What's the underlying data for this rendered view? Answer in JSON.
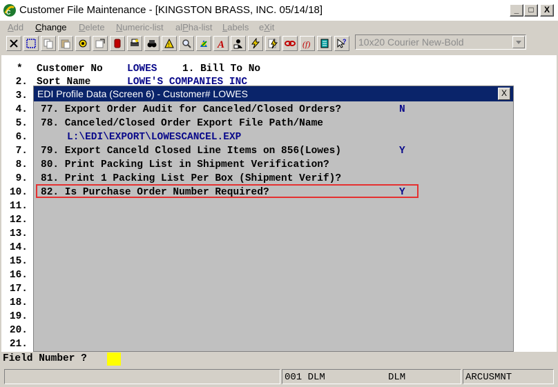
{
  "window": {
    "title": "Customer File Maintenance - [KINGSTON BRASS, INC. 05/14/18]",
    "minimize": "_",
    "maximize": "□",
    "close": "X"
  },
  "menu": {
    "add": "dd",
    "add_u": "A",
    "change": "hange",
    "change_u": "C",
    "delete": "elete",
    "delete_u": "D",
    "numeric_list": "umeric-list",
    "numeric_list_u": "N",
    "alpha_list_pre": "al",
    "alpha_list_u": "P",
    "alpha_list_post": "ha-list",
    "labels": "abels",
    "labels_u": "L",
    "exit_pre": "e",
    "exit_u": "X",
    "exit_post": "it"
  },
  "toolbar": {
    "font_combo_value": "10x20 Courier New-Bold",
    "icons": [
      "close-x-icon",
      "select-icon",
      "copy-icon",
      "paste-icon",
      "settings-icon",
      "properties-icon",
      "database-icon",
      "print-icon",
      "binoculars-icon",
      "warning-icon",
      "search-icon",
      "palette-icon",
      "font-a-icon",
      "person-icon",
      "lightning-icon",
      "lightning-page-icon",
      "link-icon",
      "function-icon",
      "list-icon",
      "help-pointer-icon"
    ]
  },
  "customer": {
    "star": "*",
    "customer_no_label": "Customer No",
    "customer_no_value": "LOWES",
    "bill_to_label": "1. Bill To No",
    "sort_name_label": "Sort Name",
    "sort_name_value": "LOWE'S COMPANIES INC"
  },
  "row_numbers": [
    "2.",
    "3.",
    "4.",
    "5.",
    "6.",
    "7.",
    "8.",
    "9.",
    "10.",
    "11.",
    "12.",
    "13.",
    "14.",
    "15.",
    "16.",
    "17.",
    "18.",
    "19.",
    "20.",
    "21."
  ],
  "dialog": {
    "title": "EDI Profile Data (Screen 6) - Customer# LOWES",
    "close": "X",
    "lines": [
      {
        "text": "77. Export Order Audit for Canceled/Closed Orders?",
        "value": "N"
      },
      {
        "text": "78. Canceled/Closed Order Export File Path/Name",
        "value": ""
      },
      {
        "text": "",
        "value": "L:\\EDI\\EXPORT\\LOWESCANCEL.EXP"
      },
      {
        "text": "79. Export Canceld Closed Line Items on 856(Lowes)",
        "value": "Y"
      },
      {
        "text": "80. Print Packing List in Shipment Verification?",
        "value": ""
      },
      {
        "text": "81. Print 1 Packing List Per Box (Shipment Verif)?",
        "value": ""
      },
      {
        "text": "82. Is Purchase Order Number Required?",
        "value": "Y"
      }
    ]
  },
  "field": {
    "label": "Field Number ?",
    "value": ""
  },
  "status": {
    "pane1": "",
    "pane2": "001 DLM",
    "pane3": "DLM",
    "pane4": "ARCUSMNT"
  }
}
